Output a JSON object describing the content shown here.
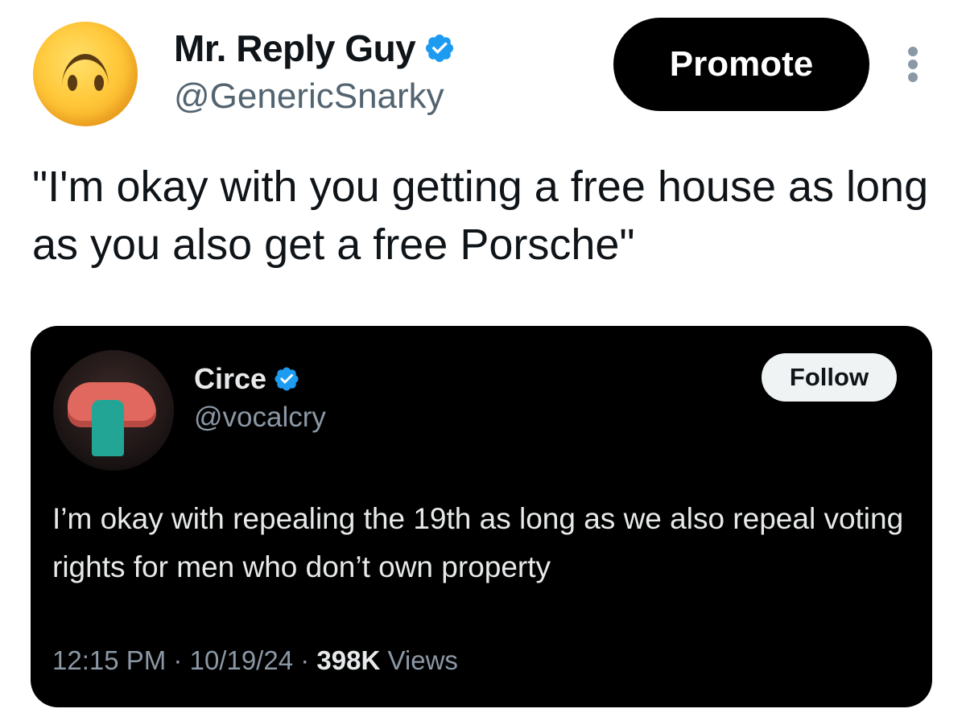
{
  "tweet": {
    "author": {
      "display_name": "Mr. Reply Guy",
      "handle": "@GenericSnarky",
      "verified": true,
      "avatar": "upside-down-face-emoji"
    },
    "promote_label": "Promote",
    "more_icon": "more-vertical-icon",
    "text": "\"I'm okay with you getting a free house as long as you also get a free Porsche\""
  },
  "quoted_tweet": {
    "author": {
      "display_name": "Circe",
      "handle": "@vocalcry",
      "verified": true,
      "avatar": "profile-photo"
    },
    "follow_label": "Follow",
    "text": "I’m okay with repealing the 19th as long as we also repeal voting rights for men who don’t own property",
    "time": "12:15 PM",
    "separator": "·",
    "date": "10/19/24",
    "views_count": "398K",
    "views_label": "Views"
  },
  "colors": {
    "verified_blue": "#1d9bf0",
    "primary_text": "#0f1419",
    "secondary_text": "#536471",
    "dark_card": "#000000",
    "dark_primary_text": "#e7e9ea",
    "dark_secondary_text": "#8b98a5"
  }
}
